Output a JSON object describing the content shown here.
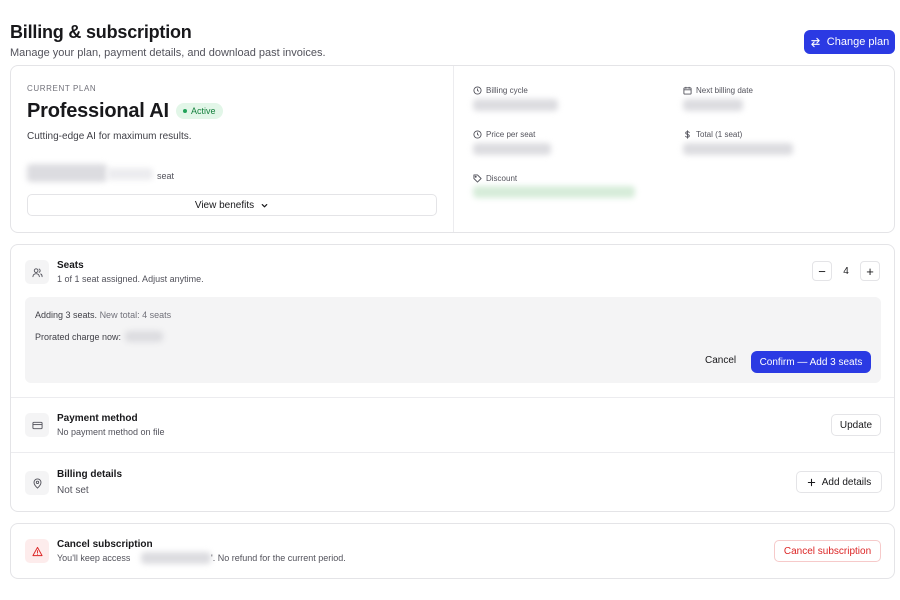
{
  "header": {
    "title": "Billing & subscription",
    "subtitle": "Manage your plan, payment details, and download past invoices.",
    "change_plan_label": "Change plan"
  },
  "plan": {
    "section_label": "CURRENT PLAN",
    "name": "Professional AI",
    "status": "Active",
    "description": "Cutting-edge AI for maximum results.",
    "seat_unit": "seat",
    "view_benefits_label": "View benefits"
  },
  "meta": {
    "billing_cycle_label": "Billing cycle",
    "next_billing_label": "Next billing date",
    "price_per_seat_label": "Price per seat",
    "total_label": "Total (1 seat)",
    "discount_label": "Discount"
  },
  "seats": {
    "title": "Seats",
    "subtitle": "1 of 1 seat assigned. Adjust anytime.",
    "count": "4",
    "decrement_label": "−",
    "increment_label": "+",
    "adding_text": "Adding 3 seats.",
    "new_total_text": "New total: 4 seats",
    "prorated_label": "Prorated charge now:",
    "cancel_label": "Cancel",
    "confirm_label": "Confirm — Add 3 seats"
  },
  "payment": {
    "title": "Payment method",
    "subtitle": "No payment method on file",
    "update_label": "Update"
  },
  "billing_details": {
    "title": "Billing details",
    "subtitle": "Not set",
    "add_label": "Add details"
  },
  "cancel_subscription": {
    "title": "Cancel subscription",
    "sub_prefix": "You'll keep access",
    "sub_suffix": "'. No refund for the current period.",
    "button_label": "Cancel subscription"
  },
  "colors": {
    "primary": "#2b3ae3",
    "success_bg": "#e2f6e8",
    "success_text": "#15803d",
    "danger": "#dc2626"
  }
}
